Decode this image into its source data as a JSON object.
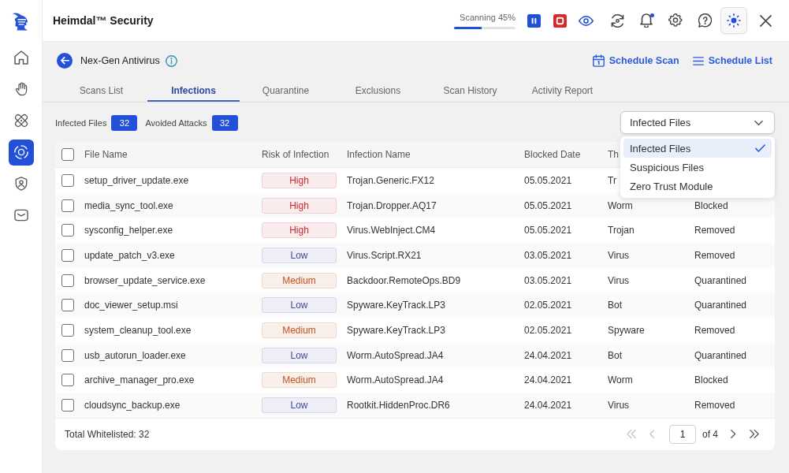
{
  "app": {
    "title": "Heimdal™ Security"
  },
  "scan": {
    "label": "Scanning 45%",
    "level": 0.45
  },
  "toolbar": [
    {
      "kind": "pause",
      "active": false,
      "notification": false
    },
    {
      "kind": "stop",
      "active": false,
      "notification": false
    },
    {
      "kind": "eye",
      "active": false,
      "notification": false
    },
    {
      "kind": "sync",
      "active": false,
      "notification": false
    },
    {
      "kind": "bell",
      "active": false,
      "notification": true
    },
    {
      "kind": "settings",
      "active": false,
      "notification": false
    },
    {
      "kind": "help",
      "active": false,
      "notification": false
    },
    {
      "kind": "theme",
      "active": true,
      "notification": false
    }
  ],
  "sidebar": {
    "items": [
      {
        "kind": "home",
        "selected": false
      },
      {
        "kind": "hand",
        "selected": false
      },
      {
        "kind": "bandage",
        "selected": false
      },
      {
        "kind": "scan",
        "selected": true
      },
      {
        "kind": "shield",
        "selected": false
      },
      {
        "kind": "mail",
        "selected": false
      }
    ]
  },
  "page": {
    "title": "Nex-Gen Antivirus",
    "actions": [
      {
        "kind": "calendar",
        "label": "Schedule Scan"
      },
      {
        "kind": "list",
        "label": "Schedule List"
      }
    ]
  },
  "tabs": [
    {
      "label": "Scans List",
      "selected": false
    },
    {
      "label": "Infections",
      "selected": true
    },
    {
      "label": "Quarantine",
      "selected": false
    },
    {
      "label": "Exclusions",
      "selected": false
    },
    {
      "label": "Scan History",
      "selected": false
    },
    {
      "label": "Activity Report",
      "selected": false
    }
  ],
  "stats": [
    {
      "label": "Infected Files",
      "count": "32"
    },
    {
      "label": "Avoided Attacks",
      "count": "32"
    }
  ],
  "filter": {
    "value": "Infected Files",
    "expanded": true,
    "options": [
      {
        "label": "Infected Files",
        "selected": true
      },
      {
        "label": "Suspicious Files",
        "selected": false
      },
      {
        "label": "Zero Trust Module",
        "selected": false
      }
    ]
  },
  "table": {
    "checked": false,
    "columns": [
      "File Name",
      "Risk of Infection",
      "Infection Name",
      "Blocked Date",
      "Th"
    ],
    "rows": [
      {
        "checked": false,
        "file_name": "setup_driver_update.exe",
        "risk": {
          "label": "High",
          "color": "#c62b35"
        },
        "infection_name": "Trojan.Generic.FX12",
        "blocked_date": "05.05.2021",
        "column_5": "Tr"
      },
      {
        "checked": false,
        "file_name": "media_sync_tool.exe",
        "risk": {
          "label": "High",
          "color": "#c62b35"
        },
        "infection_name": "Trojan.Dropper.AQ17",
        "blocked_date": "05.05.2021",
        "column_5": "Worm",
        "column_6": "Blocked"
      },
      {
        "checked": false,
        "file_name": "sysconfig_helper.exe",
        "risk": {
          "label": "High",
          "color": "#c62b35"
        },
        "infection_name": "Virus.WebInject.CM4",
        "blocked_date": "05.05.2021",
        "column_5": "Trojan",
        "column_6": "Removed"
      },
      {
        "checked": false,
        "file_name": "update_patch_v3.exe",
        "risk": {
          "label": "Low",
          "color": "#45499a"
        },
        "infection_name": "Virus.Script.RX21",
        "blocked_date": "03.05.2021",
        "column_5": "Virus",
        "column_6": "Removed"
      },
      {
        "checked": false,
        "file_name": "browser_update_service.exe",
        "risk": {
          "label": "Medium",
          "color": "#c0541d"
        },
        "infection_name": "Backdoor.RemoteOps.BD9",
        "blocked_date": "03.05.2021",
        "column_5": "Virus",
        "column_6": "Quarantined"
      },
      {
        "checked": false,
        "file_name": "doc_viewer_setup.msi",
        "risk": {
          "label": "Low",
          "color": "#45499a"
        },
        "infection_name": "Spyware.KeyTrack.LP3",
        "blocked_date": "02.05.2021",
        "column_5": "Bot",
        "column_6": "Quarantined"
      },
      {
        "checked": false,
        "file_name": "system_cleanup_tool.exe",
        "risk": {
          "label": "Medium",
          "color": "#c0541d"
        },
        "infection_name": "Spyware.KeyTrack.LP3",
        "blocked_date": "02.05.2021",
        "column_5": "Spyware",
        "column_6": "Removed"
      },
      {
        "checked": false,
        "file_name": "usb_autorun_loader.exe",
        "risk": {
          "label": "Low",
          "color": "#45499a"
        },
        "infection_name": "Worm.AutoSpread.JA4",
        "blocked_date": "24.04.2021",
        "column_5": "Bot",
        "column_6": "Quarantined"
      },
      {
        "checked": false,
        "file_name": "archive_manager_pro.exe",
        "risk": {
          "label": "Medium",
          "color": "#c0541d"
        },
        "infection_name": "Worm.AutoSpread.JA4",
        "blocked_date": "24.04.2021",
        "column_5": "Worm",
        "column_6": "Blocked"
      },
      {
        "checked": false,
        "file_name": "cloudsync_backup.exe",
        "risk": {
          "label": "Low",
          "color": "#45499a"
        },
        "infection_name": "Rootkit.HiddenProc.DR6",
        "blocked_date": "24.04.2021",
        "column_5": "Virus",
        "column_6": "Removed"
      }
    ]
  },
  "footer": {
    "total": "Total Whitelisted: 32",
    "pagination": {
      "first": {
        "disabled": true
      },
      "previous": {
        "disabled": true
      },
      "page": "1",
      "page_count": "of 4",
      "next": {
        "disabled": false
      },
      "last": {
        "disabled": false
      }
    }
  }
}
